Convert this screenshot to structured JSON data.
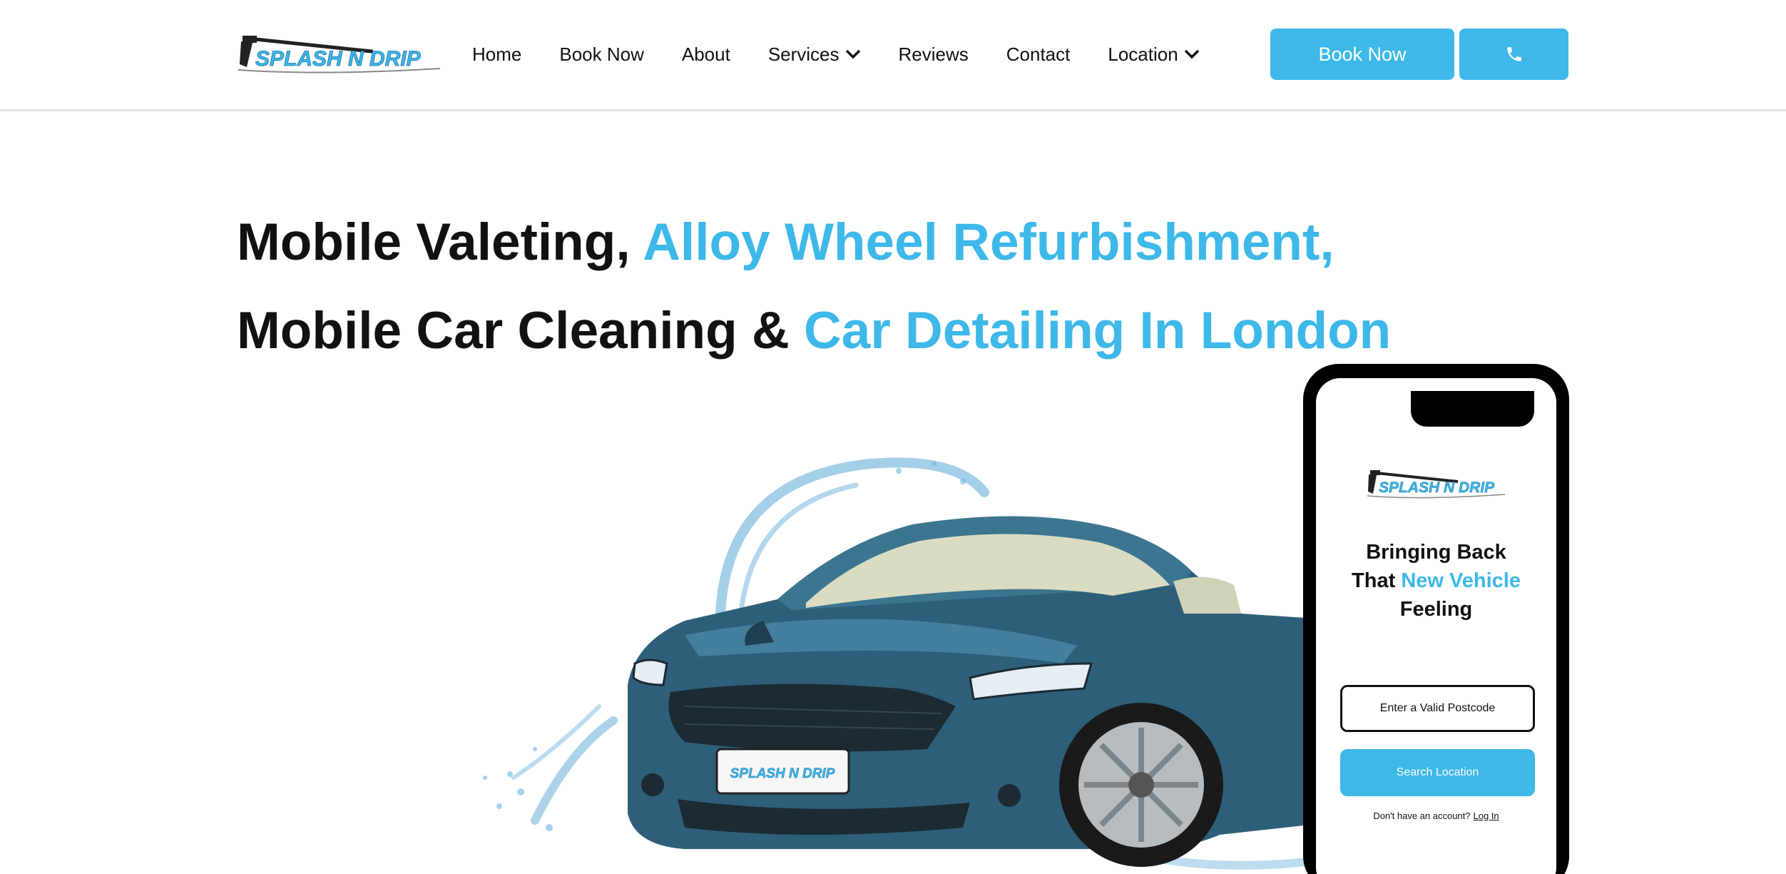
{
  "brand": {
    "logo_text": "SPLASH N DRIP",
    "accent_color": "#3db8e8"
  },
  "nav": {
    "items": [
      {
        "label": "Home",
        "has_dropdown": false
      },
      {
        "label": "Book Now",
        "has_dropdown": false
      },
      {
        "label": "About",
        "has_dropdown": false
      },
      {
        "label": "Services",
        "has_dropdown": true
      },
      {
        "label": "Reviews",
        "has_dropdown": false
      },
      {
        "label": "Contact",
        "has_dropdown": false
      },
      {
        "label": "Location",
        "has_dropdown": true
      }
    ],
    "book_button_label": "Book Now",
    "phone_icon": "phone-icon"
  },
  "hero": {
    "line1_dark": "Mobile Valeting,",
    "line1_accent": "Alloy Wheel Refurbishment,",
    "line2_dark": "Mobile Car Cleaning &",
    "line2_accent": "Car Detailing In London",
    "plate_text": "SPLASH N DRIP"
  },
  "phone": {
    "logo_text": "SPLASH N DRIP",
    "title_line1": "Bringing Back",
    "title_line2_dark": "That",
    "title_line2_accent": "New Vehicle",
    "title_line3": "Feeling",
    "postcode_placeholder": "Enter a Valid Postcode",
    "search_button_label": "Search Location",
    "footer_text": "Don't have an account?",
    "login_link": "Log In"
  }
}
